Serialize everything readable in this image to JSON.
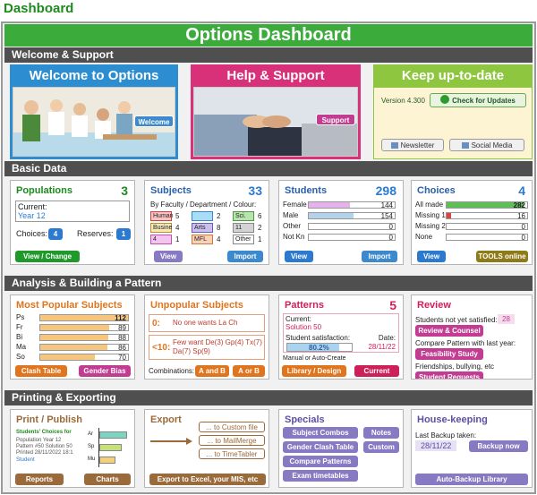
{
  "page_title": "Dashboard",
  "banner": "Options Dashboard",
  "sections": {
    "welcome": "Welcome & Support",
    "basic": "Basic Data",
    "analysis": "Analysis & Building a Pattern",
    "printing": "Printing & Exporting"
  },
  "welcome_card": {
    "title": "Welcome to Options",
    "button": "Welcome"
  },
  "support_card": {
    "title": "Help & Support",
    "button": "Support"
  },
  "update_card": {
    "title": "Keep up-to-date",
    "version": "Version 4.300",
    "check_button": "Check for Updates",
    "newsletter": "Newsletter",
    "social": "Social Media"
  },
  "populations": {
    "title": "Populations",
    "count": "3",
    "current_label": "Current:",
    "current_value": "Year 12",
    "choices_label": "Choices:",
    "choices_value": "4",
    "reserves_label": "Reserves:",
    "reserves_value": "1",
    "button": "View / Change"
  },
  "subjects": {
    "title": "Subjects",
    "count": "33",
    "subtitle": "By Faculty / Department / Colour:",
    "faculties": [
      {
        "name": "Human",
        "count": "5",
        "color": "#f6c4c4",
        "border": "#d04040"
      },
      {
        "name": "",
        "count": "2",
        "color": "#a9dcf5",
        "border": "#3a88c0"
      },
      {
        "name": "Sci.",
        "count": "6",
        "color": "#b9e2ae",
        "border": "#4a9a40"
      },
      {
        "name": "Busine",
        "count": "4",
        "color": "#f7e7b9",
        "border": "#b79030"
      },
      {
        "name": "Arts",
        "count": "8",
        "color": "#cac0ec",
        "border": "#6a5ab0"
      },
      {
        "name": "11",
        "count": "2",
        "color": "#d3d3d3",
        "border": "#888888"
      },
      {
        "name": "4",
        "count": "1",
        "color": "#f3c6ef",
        "border": "#c050b0"
      },
      {
        "name": "MFL",
        "count": "4",
        "color": "#f8d1b6",
        "border": "#d07840"
      },
      {
        "name": "Other",
        "count": "1",
        "color": "#ffffff",
        "border": "#888888"
      }
    ],
    "view": "View",
    "import": "Import"
  },
  "students": {
    "title": "Students",
    "count": "298",
    "rows": [
      {
        "label": "Female",
        "value": "144",
        "fraction": 0.48,
        "color": "#e5b2ea"
      },
      {
        "label": "Male",
        "value": "154",
        "fraction": 0.52,
        "color": "#b2d3ea"
      },
      {
        "label": "Other",
        "value": "0",
        "fraction": 0,
        "color": "#cccccc"
      },
      {
        "label": "Not Kn",
        "value": "0",
        "fraction": 0,
        "color": "#cccccc"
      }
    ],
    "view": "View",
    "import": "Import"
  },
  "choices": {
    "title": "Choices",
    "count": "4",
    "rows": [
      {
        "label": "All made",
        "value": "282",
        "fraction": 0.95,
        "color": "#5fbf56"
      },
      {
        "label": "Missing 1",
        "value": "16",
        "fraction": 0.05,
        "color": "#e34040"
      },
      {
        "label": "Missing 2",
        "value": "0",
        "fraction": 0,
        "color": "#cccccc"
      },
      {
        "label": "None",
        "value": "0",
        "fraction": 0,
        "color": "#cccccc"
      }
    ],
    "view": "View",
    "tools": "TOOLS online"
  },
  "popular": {
    "title": "Most Popular Subjects",
    "rows": [
      {
        "label": "Ps",
        "value": "112",
        "fraction": 1.0
      },
      {
        "label": "Fr",
        "value": "89",
        "fraction": 0.79
      },
      {
        "label": "Bi",
        "value": "88",
        "fraction": 0.78
      },
      {
        "label": "Ma",
        "value": "86",
        "fraction": 0.77
      },
      {
        "label": "So",
        "value": "70",
        "fraction": 0.62
      }
    ],
    "clash": "Clash Table",
    "gender": "Gender Bias"
  },
  "unpopular": {
    "title": "Unpopular Subjects",
    "zero_label": "0:",
    "zero_text": "No one wants  La  Ch",
    "few_label": "<10:",
    "few_text_1": "Few want  De(3)  Gp(4)  Tx(7)",
    "few_text_2": "Da(7)  Sp(9)",
    "combos_label": "Combinations:",
    "a_and_b": "A and B",
    "a_or_b": "A or B"
  },
  "patterns": {
    "title": "Patterns",
    "count": "5",
    "current_label": "Current:",
    "current_value": "Solution 50",
    "satisfaction_label": "Student satisfaction:",
    "satisfaction_value": "80.2%",
    "satisfaction_fraction": 0.802,
    "date_label": "Date:",
    "date_value": "28/11/22",
    "manual": "Manual or Auto-Create",
    "library": "Library / Design",
    "current_button": "Current"
  },
  "review": {
    "title": "Review",
    "not_satisfied": "Students not yet satisfied:",
    "not_satisfied_value": "28",
    "review_button": "Review & Counsel",
    "compare": "Compare Pattern with last year:",
    "feasibility_button": "Feasibility Study",
    "friendships": "Friendships, bullying, etc",
    "requests_button": "Student Requests"
  },
  "print": {
    "title": "Print / Publish",
    "mini_title": "Students' Choices for",
    "mini_lines": [
      "Population   Year 12",
      "Pattern #50   Solution 50",
      "Printed  28/11/2022  18:1"
    ],
    "mini_footer": "Student",
    "mini_rows": [
      {
        "label": "Ar",
        "fraction": 0.85,
        "color": "#7cd4c2"
      },
      {
        "label": "Sp",
        "fraction": 0.7,
        "color": "#c6e07a"
      },
      {
        "label": "Mu",
        "fraction": 0.5,
        "color": "#f4d07a"
      }
    ],
    "reports": "Reports",
    "charts": "Charts"
  },
  "export": {
    "title": "Export",
    "targets": [
      "... to Custom file",
      "... to MailMerge",
      "... to TimeTabler"
    ],
    "button": "Export to Excel, your MIS, etc"
  },
  "specials": {
    "title": "Specials",
    "buttons": [
      "Subject Combos",
      "Notes",
      "Gender Clash Table",
      "Custom",
      "Compare Patterns",
      "Exam timetables"
    ]
  },
  "housekeeping": {
    "title": "House-keeping",
    "last_backup": "Last Backup taken:",
    "date": "28/11/22",
    "backup_now": "Backup now",
    "auto_backup": "Auto-Backup Library"
  },
  "colors": {
    "green": "#1e8a1e",
    "blue": "#2b7ad0",
    "orange": "#e1751e",
    "red": "#cf1f58",
    "brown": "#9b6a3a",
    "purple": "#8779c2"
  }
}
